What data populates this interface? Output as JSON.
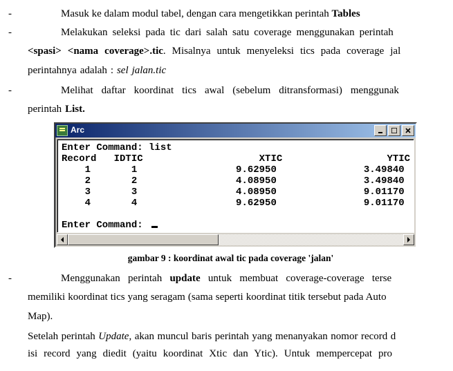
{
  "bullets": {
    "b1": {
      "dash": "-",
      "text_a": "Masuk ke dalam modul tabel, dengan cara mengetikkan perintah ",
      "bold_a": "Tables"
    },
    "b2": {
      "dash": "-",
      "line1": "Melakukan seleksi pada tic dari salah satu coverage menggunakan perintah ",
      "line2_bold": "<spasi> <nama coverage>.tic",
      "line2_rest": ". Misalnya untuk menyeleksi tics pada coverage jal",
      "line3_a": "perintahnya adalah : ",
      "line3_i": "sel jalan.tic"
    },
    "b3": {
      "dash": "-",
      "line1": "Melihat daftar koordinat tics awal (sebelum ditransformasi) menggunak",
      "line2_a": "perintah ",
      "line2_b": "List."
    },
    "b4": {
      "dash": "-",
      "line1_a": "Menggunakan perintah ",
      "line1_bold": "update",
      "line1_b": " untuk membuat coverage-coverage terse",
      "line2": "memiliki koordinat tics yang seragam (sama seperti koordinat titik tersebut pada Auto",
      "line3": "Map)."
    }
  },
  "setelah": {
    "line1_a": "Setelah perintah ",
    "line1_i": "Update",
    "line1_b": ", akan muncul baris perintah yang menanyakan nomor record d",
    "line2": "isi record yang diedit (yaitu koordinat Xtic dan Ytic). Untuk mempercepat pro"
  },
  "arc": {
    "title": "Arc",
    "btn_min": "min",
    "btn_max": "max",
    "btn_close": "close",
    "prompt1": "Enter Command: list",
    "header": "Record   IDTIC                    XTIC                  YTIC",
    "rows": [
      "    1       1                 9.62950               3.49840",
      "    2       2                 4.08950               3.49840",
      "    3       3                 4.08950               9.01170",
      "    4       4                 9.62950               9.01170"
    ],
    "prompt2": "Enter Command: "
  },
  "caption": "gambar 9 : koordinat awal tic pada coverage 'jalan'",
  "chart_data": {
    "type": "table",
    "title": "koordinat awal tic pada coverage 'jalan'",
    "columns": [
      "Record",
      "IDTIC",
      "XTIC",
      "YTIC"
    ],
    "rows": [
      [
        1,
        1,
        9.6295,
        3.4984
      ],
      [
        2,
        2,
        4.0895,
        3.4984
      ],
      [
        3,
        3,
        4.0895,
        9.0117
      ],
      [
        4,
        4,
        9.6295,
        9.0117
      ]
    ]
  }
}
